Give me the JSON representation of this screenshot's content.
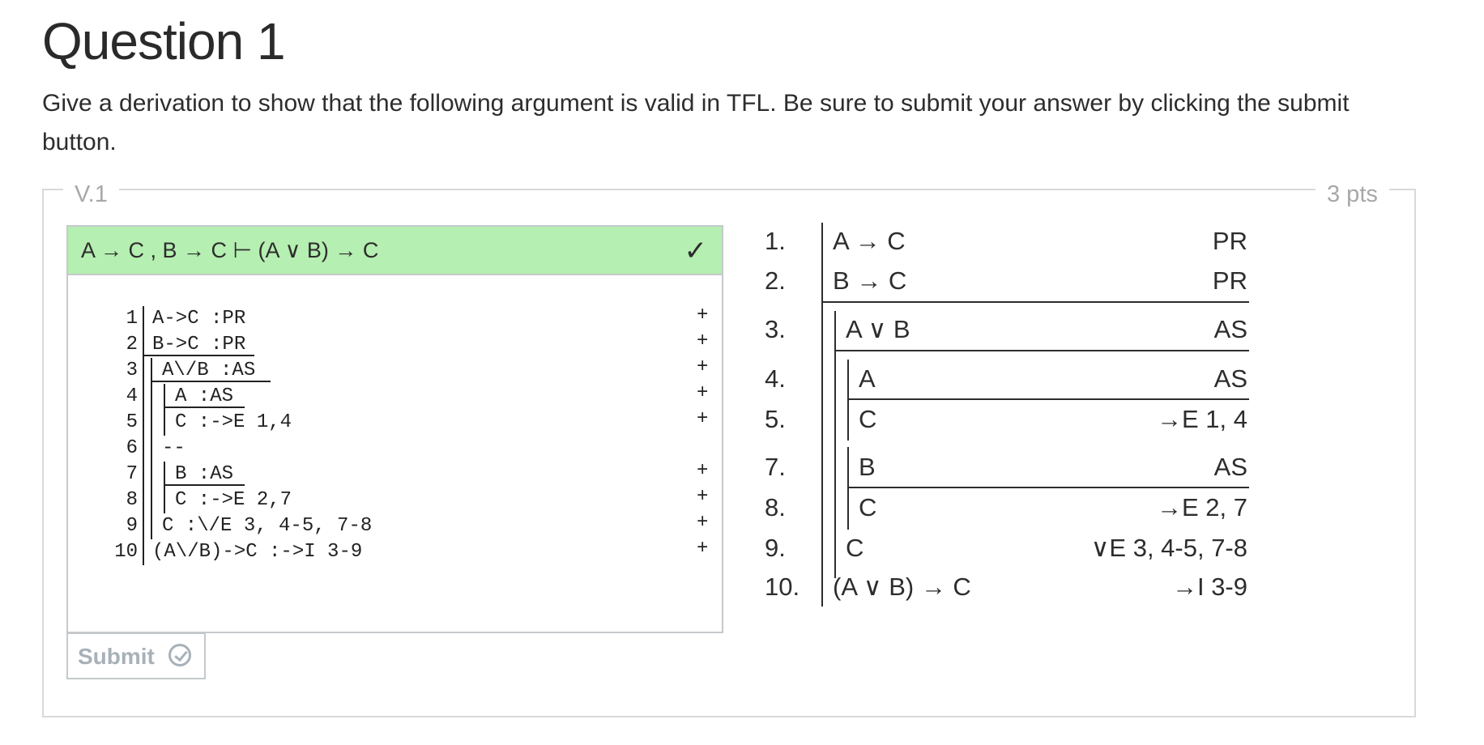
{
  "question": {
    "title": "Question 1",
    "text": "Give a derivation to show that the following argument is valid in TFL. Be sure to submit your answer by clicking the submit button."
  },
  "box": {
    "version": "V.1",
    "points": "3 pts"
  },
  "editor": {
    "sequent": "A → C , B → C ⊢ (A ∨ B) → C",
    "check": "✓",
    "lines": [
      {
        "num": "1",
        "text": "A->C :PR",
        "plus": "+"
      },
      {
        "num": "2",
        "text": "B->C :PR",
        "plus": "+"
      },
      {
        "num": "3",
        "text": "A\\/B :AS",
        "plus": "+"
      },
      {
        "num": "4",
        "text": "A :AS",
        "plus": "+"
      },
      {
        "num": "5",
        "text": "C :->E 1,4",
        "plus": "+"
      },
      {
        "num": "6",
        "text": "--",
        "plus": ""
      },
      {
        "num": "7",
        "text": "B :AS",
        "plus": "+"
      },
      {
        "num": "8",
        "text": "C :->E 2,7",
        "plus": "+"
      },
      {
        "num": "9",
        "text": "C :\\/E 3, 4-5, 7-8",
        "plus": "+"
      },
      {
        "num": "10",
        "text": "(A\\/B)->C :->I 3-9",
        "plus": "+"
      }
    ]
  },
  "submit": {
    "label": "Submit"
  },
  "rendered_proof": [
    {
      "num": "1.",
      "formula": "A → C",
      "just": "PR"
    },
    {
      "num": "2.",
      "formula": "B → C",
      "just": "PR"
    },
    {
      "num": "3.",
      "formula": "A ∨ B",
      "just": "AS"
    },
    {
      "num": "4.",
      "formula": "A",
      "just": "AS"
    },
    {
      "num": "5.",
      "formula": "C",
      "just": "→E 1, 4"
    },
    {
      "num": "7.",
      "formula": "B",
      "just": "AS"
    },
    {
      "num": "8.",
      "formula": "C",
      "just": "→E 2, 7"
    },
    {
      "num": "9.",
      "formula": "C",
      "just": "∨E 3, 4-5, 7-8"
    },
    {
      "num": "10.",
      "formula": "(A ∨ B) → C",
      "just": "→I 3-9"
    }
  ],
  "colors": {
    "valid_bg": "#b5efb1",
    "border": "#c5c9cc",
    "muted": "#a8a8a8",
    "submit_text": "#a7b1b8"
  }
}
